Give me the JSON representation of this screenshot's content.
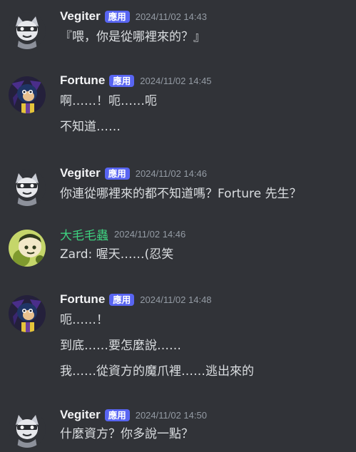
{
  "bot_tag": "應用",
  "messages": [
    {
      "author": "Vegiter",
      "bot": true,
      "timestamp": "2024/11/02 14:43",
      "lines": [
        "『喂，你是從哪裡來的？』"
      ]
    },
    {
      "author": "Fortune",
      "bot": true,
      "timestamp": "2024/11/02 14:45",
      "lines": [
        "啊……！呃……呃",
        "不知道……"
      ]
    },
    {
      "author": "Vegiter",
      "bot": true,
      "timestamp": "2024/11/02 14:46",
      "lines": [
        "你連從哪裡來的都不知道嗎？Forture 先生？"
      ]
    },
    {
      "author": "大毛毛蟲",
      "bot": false,
      "timestamp": "2024/11/02 14:46",
      "lines": [
        "Zard: 喔天……(忍笑"
      ]
    },
    {
      "author": "Fortune",
      "bot": true,
      "timestamp": "2024/11/02 14:48",
      "lines": [
        "呃……！",
        "到底……要怎麼說……",
        "我……從資方的魔爪裡……逃出來的"
      ]
    },
    {
      "author": "Vegiter",
      "bot": true,
      "timestamp": "2024/11/02 14:50",
      "lines": [
        "什麼資方？你多說一點？"
      ]
    }
  ],
  "colors": {
    "background": "#313338",
    "text": "#dbdee1",
    "username": "#f2f3f5",
    "username_green": "#3ed07f",
    "bot_tag": "#5865f2",
    "timestamp": "#949ba4"
  }
}
